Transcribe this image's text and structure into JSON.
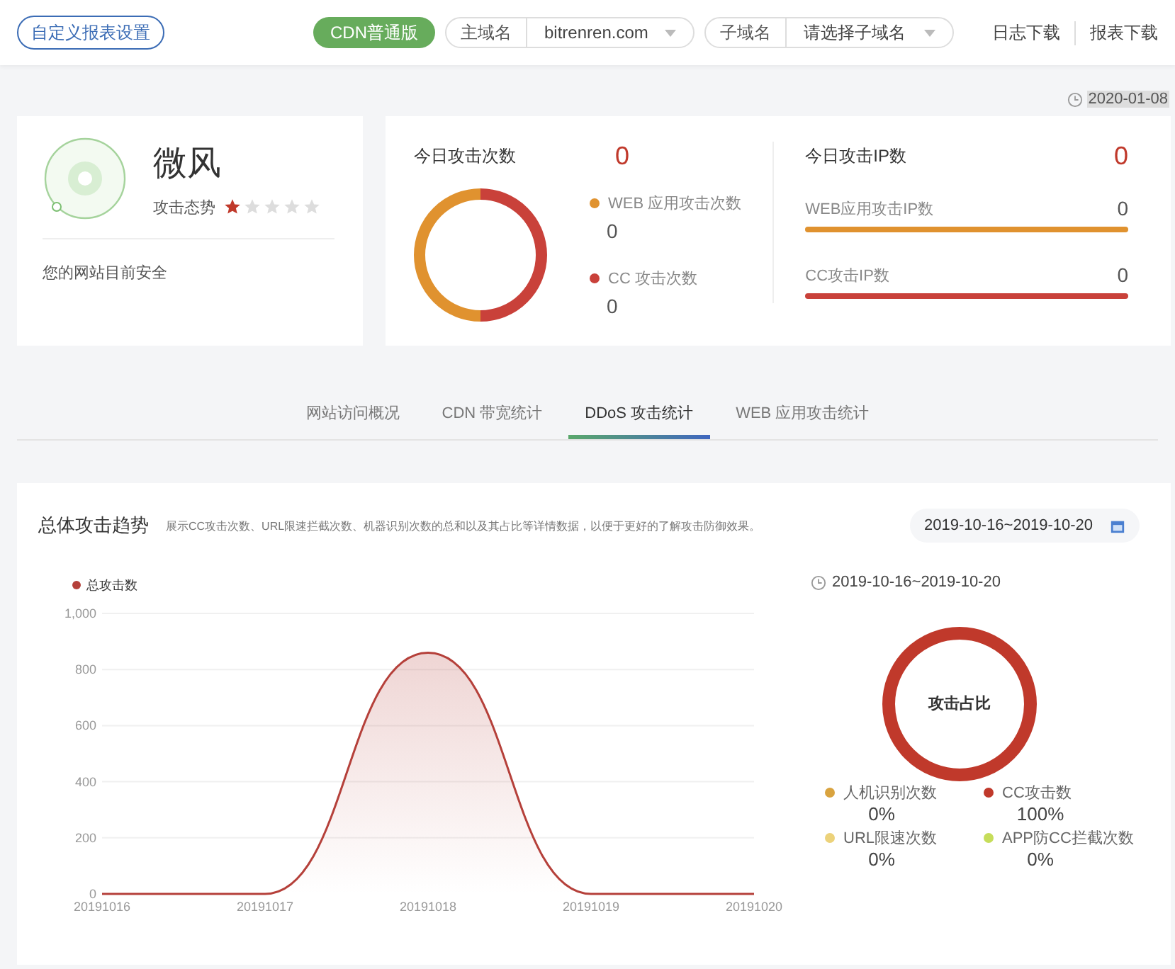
{
  "header": {
    "custom_button": "自定义报表设置",
    "plan_badge": "CDN普通版",
    "domain": {
      "label": "主域名",
      "value": "bitrenren.com"
    },
    "subdomain": {
      "label": "子域名",
      "placeholder": "请选择子域名"
    },
    "links": [
      "日志下载",
      "报表下载"
    ]
  },
  "date": "2020-01-08",
  "status": {
    "title": "微风",
    "trend_label": "攻击态势",
    "stars": 1,
    "message": "您的网站目前安全"
  },
  "attacks": {
    "title": "今日攻击次数",
    "total": "0",
    "items": [
      {
        "label": "WEB 应用攻击次数",
        "value": "0",
        "color": "#e0922f"
      },
      {
        "label": "CC 攻击次数",
        "value": "0",
        "color": "#c9413a"
      }
    ]
  },
  "attack_ips": {
    "title": "今日攻击IP数",
    "total": "0",
    "items": [
      {
        "label": "WEB应用攻击IP数",
        "value": "0",
        "color": "#e0922f"
      },
      {
        "label": "CC攻击IP数",
        "value": "0",
        "color": "#c9413a"
      }
    ]
  },
  "tabs": [
    {
      "label": "网站访问概况",
      "selected": false
    },
    {
      "label": "CDN 带宽统计",
      "selected": false
    },
    {
      "label": "DDoS 攻击统计",
      "selected": true
    },
    {
      "label": "WEB 应用攻击统计",
      "selected": false
    }
  ],
  "trend": {
    "title": "总体攻击趋势",
    "description": "展示CC攻击次数、URL限速拦截次数、机器识别次数的总和以及其占比等详情数据，以便于更好的了解攻击防御效果。",
    "range": "2019-10-16~2019-10-20",
    "chart_data": {
      "type": "area",
      "categories": [
        "20191016",
        "20191017",
        "20191018",
        "20191019",
        "20191020"
      ],
      "series": [
        {
          "name": "总攻击数",
          "color": "#b5403a",
          "values": [
            0,
            0,
            860,
            0,
            0
          ]
        }
      ],
      "ylim": [
        0,
        1000
      ],
      "grid": true,
      "yticks": [
        0,
        200,
        400,
        600,
        {
          "value": 1000,
          "label": "1,000"
        },
        800
      ]
    }
  },
  "ratio": {
    "range": "2019-10-16~2019-10-20",
    "center": "攻击占比",
    "items": [
      {
        "label": "人机识别次数",
        "value": "0%",
        "color": "#d9a33f"
      },
      {
        "label": "CC攻击数",
        "value": "100%",
        "color": "#c0392b"
      },
      {
        "label": "URL限速次数",
        "value": "0%",
        "color": "#ecd27a"
      },
      {
        "label": "APP防CC拦截次数",
        "value": "0%",
        "color": "#c6dd5a"
      }
    ]
  }
}
